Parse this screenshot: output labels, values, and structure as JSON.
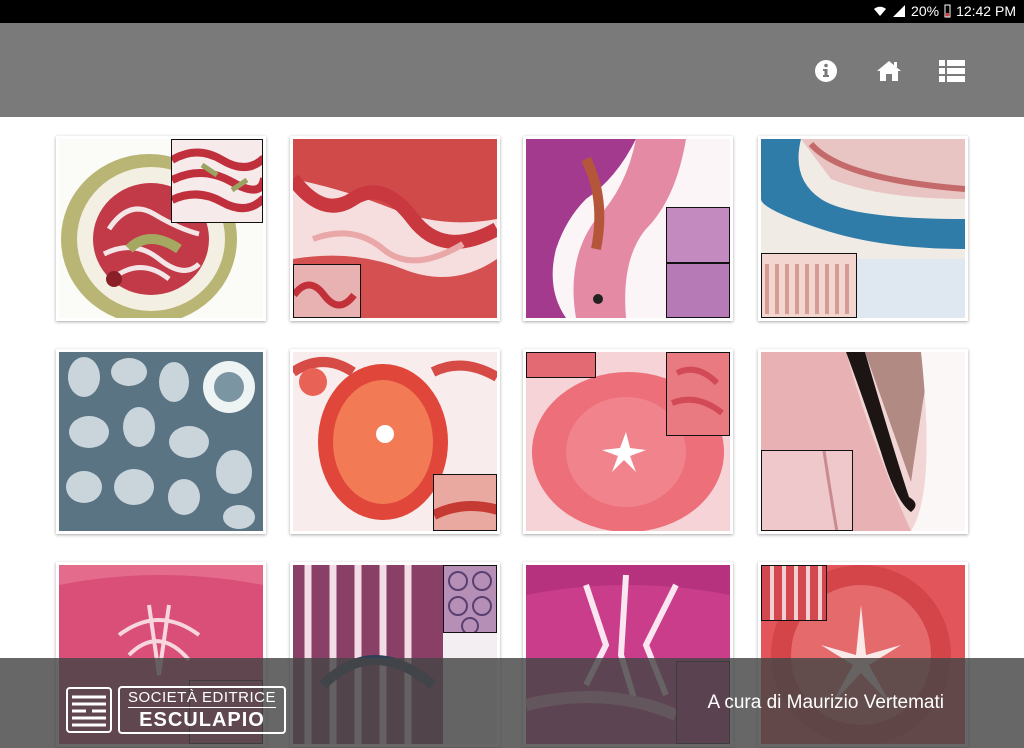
{
  "status_bar": {
    "battery": "20%",
    "time": "12:42 PM",
    "icons": [
      "wifi-icon",
      "signal-icon",
      "battery-icon"
    ]
  },
  "toolbar": {
    "actions": [
      {
        "name": "info",
        "icon": "info-icon"
      },
      {
        "name": "home",
        "icon": "home-icon"
      },
      {
        "name": "list",
        "icon": "list-icon"
      }
    ]
  },
  "gallery": {
    "tiles": [
      {
        "index": 1,
        "stain": "green-red",
        "inset": "top-right"
      },
      {
        "index": 2,
        "stain": "red",
        "inset": "bottom-left"
      },
      {
        "index": 3,
        "stain": "purple-pink",
        "inset": "right-double"
      },
      {
        "index": 4,
        "stain": "blue-pink",
        "inset": "bottom-left"
      },
      {
        "index": 5,
        "stain": "gray-blue",
        "inset": "none"
      },
      {
        "index": 6,
        "stain": "orange-red",
        "inset": "bottom-right"
      },
      {
        "index": 7,
        "stain": "pink",
        "inset": "top-left-and-right"
      },
      {
        "index": 8,
        "stain": "pale-pink",
        "inset": "bottom-left"
      },
      {
        "index": 9,
        "stain": "pink-red",
        "inset": "bottom-right"
      },
      {
        "index": 10,
        "stain": "purple-blue",
        "inset": "top-right"
      },
      {
        "index": 11,
        "stain": "magenta",
        "inset": "bottom-right"
      },
      {
        "index": 12,
        "stain": "red",
        "inset": "top-left"
      }
    ]
  },
  "footer": {
    "publisher_line1": "SOCIETÀ EDITRICE",
    "publisher_line2": "ESCULAPIO",
    "credit": "A cura di Maurizio Vertemati"
  },
  "colors": {
    "appbar": "#7a7a7a",
    "statusbar": "#000000",
    "footer_overlay": "#464646"
  }
}
